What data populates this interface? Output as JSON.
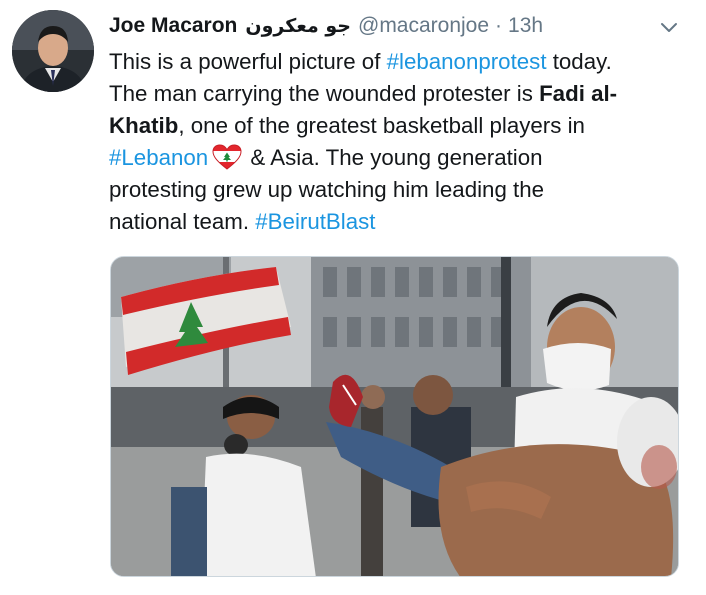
{
  "tweet": {
    "display_name": "Joe Macaron",
    "arabic_name": "جو معكرون",
    "handle": "@macaronjoe",
    "separator": "·",
    "time": "13h",
    "text": {
      "l1_a": "This is a powerful picture of ",
      "l1_tag": "#lebanonprotest",
      "l1_b": " today.",
      "l2_a": "The man carrying the wounded protester is ",
      "l2_bold": "Fadi al-",
      "l3_bold": "Khatib",
      "l3_b": ", one of the greatest basketball players in",
      "l4_tag": "#Lebanon",
      "l4_b": " & Asia. The young generation",
      "l5": "protesting grew up watching him leading the",
      "l6_a": "national team. ",
      "l6_tag": "#BeirutBlast"
    },
    "icons": {
      "caret": "chevron-down-icon",
      "heart_emoji": "lebanon-heart-emoji"
    },
    "colors": {
      "link": "#1b95e0",
      "secondary": "#657786",
      "text": "#14171a"
    }
  }
}
